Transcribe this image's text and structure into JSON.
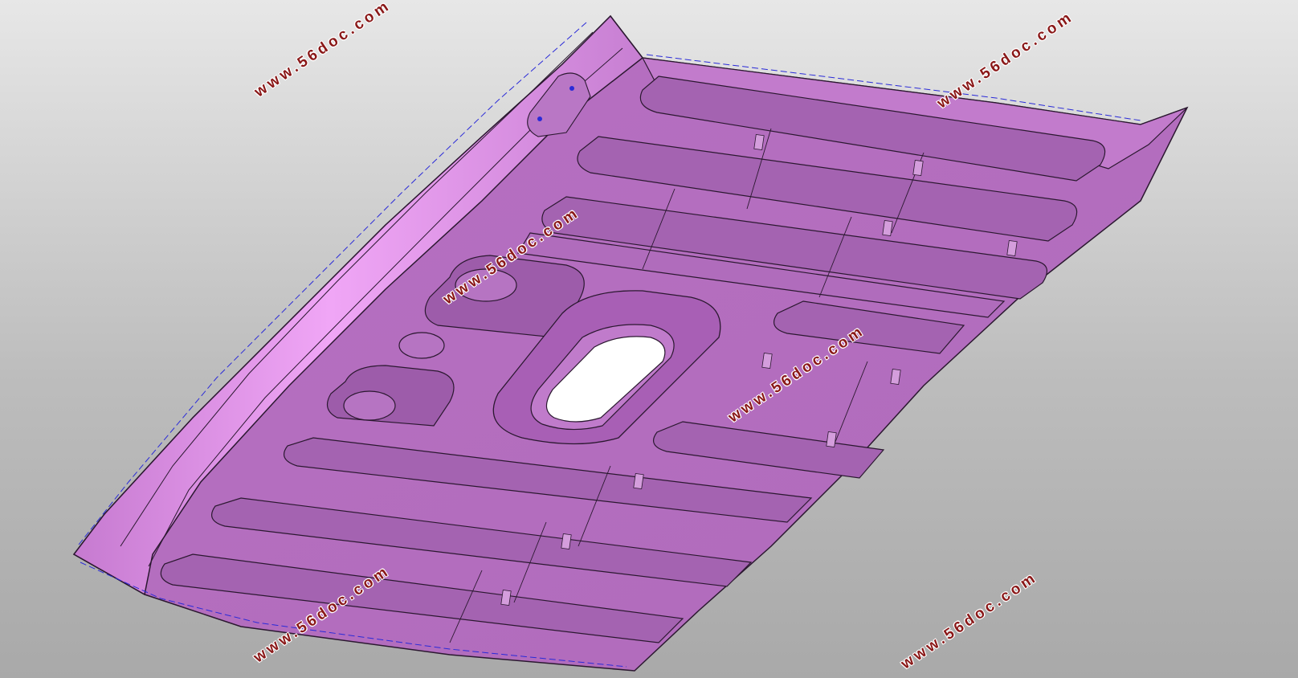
{
  "watermark": {
    "text": "www.56doc.com",
    "color": "#8a1818"
  },
  "viewport": {
    "background_top": "#e7e7e7",
    "background_bottom": "#a9a9a9"
  },
  "model": {
    "part_color": "#b56fbf",
    "flange_color": "#e79cf0",
    "edge_color": "#2b1830",
    "hidden_edge_color": "#2a2ad8",
    "hole_color": "#ffffff"
  }
}
